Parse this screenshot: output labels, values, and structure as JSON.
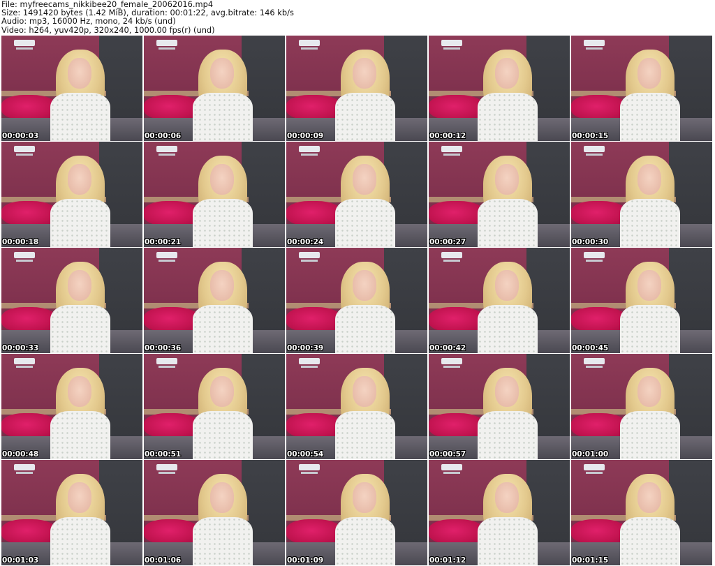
{
  "header": {
    "file_line": "File: myfreecams_nikkibee20_female_20062016.mp4",
    "size_line": "Size: 1491420 bytes (1.42 MiB), duration: 00:01:22, avg.bitrate: 146 kb/s",
    "audio_line": "Audio: mp3, 16000 Hz, mono, 24 kb/s (und)",
    "video_line": "Video: h264, yuv420p, 320x240, 1000.00 fps(r) (und)"
  },
  "thumbnails": [
    "00:00:03",
    "00:00:06",
    "00:00:09",
    "00:00:12",
    "00:00:15",
    "00:00:18",
    "00:00:21",
    "00:00:24",
    "00:00:27",
    "00:00:30",
    "00:00:33",
    "00:00:36",
    "00:00:39",
    "00:00:42",
    "00:00:45",
    "00:00:48",
    "00:00:51",
    "00:00:54",
    "00:00:57",
    "00:01:00",
    "00:01:03",
    "00:01:06",
    "00:01:09",
    "00:01:12",
    "00:01:15"
  ]
}
